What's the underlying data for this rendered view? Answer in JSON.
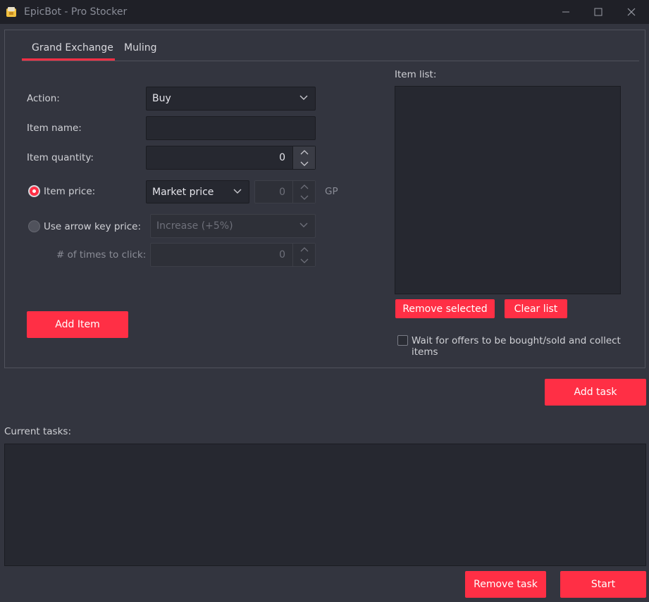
{
  "window": {
    "title": "EpicBot - Pro Stocker",
    "minimize_icon": "minimize-icon",
    "maximize_icon": "maximize-icon",
    "close_icon": "close-icon"
  },
  "tabs": [
    {
      "label": "Grand Exchange",
      "active": true
    },
    {
      "label": "Muling",
      "active": false
    }
  ],
  "form": {
    "action_label": "Action:",
    "action_value": "Buy",
    "item_name_label": "Item name:",
    "item_name_value": "",
    "item_quantity_label": "Item quantity:",
    "item_quantity_value": "0",
    "item_price_label": "Item price:",
    "item_price_selected": true,
    "price_mode_value": "Market price",
    "price_amount_value": "0",
    "price_unit": "GP",
    "arrow_price_label": "Use arrow key price:",
    "arrow_price_selected": false,
    "arrow_mode_value": "Increase (+5%)",
    "clicks_label": "# of times to click:",
    "clicks_value": "0",
    "add_item_button": "Add Item"
  },
  "item_list": {
    "label": "Item list:",
    "items": [],
    "remove_selected_button": "Remove selected",
    "clear_list_button": "Clear list",
    "wait_checkbox_label": "Wait for offers to be bought/sold and collect items",
    "wait_checked": false
  },
  "tasks": {
    "add_task_button": "Add task",
    "current_label": "Current tasks:",
    "items": [],
    "remove_task_button": "Remove task",
    "start_button": "Start"
  },
  "colors": {
    "accent": "#ff2f45",
    "background": "#33353f",
    "titlebar": "#1f2027"
  }
}
